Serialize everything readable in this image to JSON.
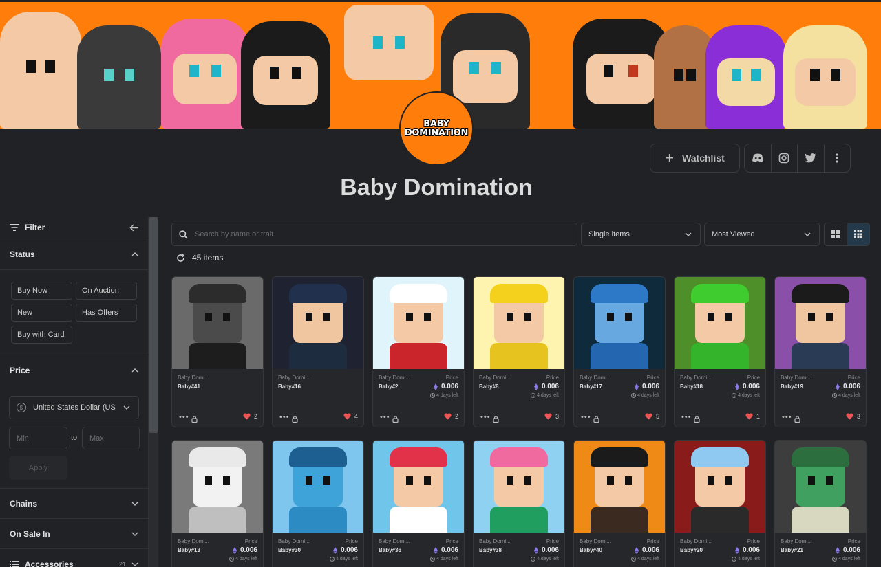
{
  "collection": {
    "title": "Baby Domination",
    "logo_line1": "BABY",
    "logo_line2": "DOMINATION"
  },
  "header": {
    "watchlist_label": "Watchlist",
    "social_icons": [
      "discord-icon",
      "instagram-icon",
      "twitter-icon",
      "more-vertical-icon"
    ]
  },
  "sidebar": {
    "filter_label": "Filter",
    "status": {
      "label": "Status",
      "options": [
        "Buy Now",
        "On Auction",
        "New",
        "Has Offers",
        "Buy with Card"
      ]
    },
    "price": {
      "label": "Price",
      "currency": "United States Dollar (US",
      "min_placeholder": "Min",
      "to_label": "to",
      "max_placeholder": "Max",
      "apply_label": "Apply"
    },
    "chains_label": "Chains",
    "on_sale_label": "On Sale In",
    "accessories_label": "Accessories",
    "accessories_count": "21"
  },
  "toolbar": {
    "search_placeholder": "Search by name or trait",
    "type_select": "Single items",
    "sort_select": "Most Viewed",
    "item_count": "45 items"
  },
  "colors": {
    "banner": "#ff7e0b",
    "background": "#202225",
    "like_heart": "#eb5757",
    "eth": "#8a7bf3"
  },
  "items": [
    {
      "collection": "Baby Domi...",
      "name": "Baby#41",
      "price_label": "",
      "price": "",
      "time_left": "",
      "likes": "2",
      "bg": "#6a6a6a",
      "skin": "#4b4b4b",
      "hat": "#2c2c2c",
      "shirt": "#1d1d1d"
    },
    {
      "collection": "Baby Domi...",
      "name": "Baby#16",
      "price_label": "",
      "price": "",
      "time_left": "",
      "likes": "4",
      "bg": "#1f2230",
      "skin": "#f0c6a0",
      "hat": "#21304d",
      "shirt": "#1d2d3f"
    },
    {
      "collection": "Baby Domi...",
      "name": "Baby#2",
      "price_label": "Price",
      "price": "0.006",
      "time_left": "4 days left",
      "likes": "2",
      "bg": "#dff4fb",
      "skin": "#f3c9a6",
      "hat": "#ffffff",
      "shirt": "#c9252a"
    },
    {
      "collection": "Baby Domi...",
      "name": "Baby#8",
      "price_label": "Price",
      "price": "0.006",
      "time_left": "4 days left",
      "likes": "3",
      "bg": "#fff3b0",
      "skin": "#f3c9a6",
      "hat": "#f4d11d",
      "shirt": "#e6c31f"
    },
    {
      "collection": "Baby Domi...",
      "name": "Baby#17",
      "price_label": "Price",
      "price": "0.006",
      "time_left": "4 days left",
      "likes": "5",
      "bg": "#0f2a3a",
      "skin": "#67a8e0",
      "hat": "#2e78c8",
      "shirt": "#2466b0"
    },
    {
      "collection": "Baby Domi...",
      "name": "Baby#18",
      "price_label": "Price",
      "price": "0.006",
      "time_left": "4 days left",
      "likes": "1",
      "bg": "#4e8f2a",
      "skin": "#f3c9a6",
      "hat": "#3fcc2e",
      "shirt": "#33b42a"
    },
    {
      "collection": "Baby Domi...",
      "name": "Baby#19",
      "price_label": "Price",
      "price": "0.006",
      "time_left": "4 days left",
      "likes": "3",
      "bg": "#8a4fa8",
      "skin": "#f0c6a0",
      "hat": "#1b1b1b",
      "shirt": "#2a3b55"
    },
    {
      "collection": "Baby Domi...",
      "name": "Baby#13",
      "price_label": "Price",
      "price": "0.006",
      "time_left": "4 days left",
      "likes": "",
      "bg": "#7a7a7a",
      "skin": "#f2f2f2",
      "hat": "#e9e9e9",
      "shirt": "#bfbfbf"
    },
    {
      "collection": "Baby Domi...",
      "name": "Baby#30",
      "price_label": "Price",
      "price": "0.006",
      "time_left": "4 days left",
      "likes": "",
      "bg": "#7ec6ee",
      "skin": "#3ea3d8",
      "hat": "#1e5f92",
      "shirt": "#2d8bc4"
    },
    {
      "collection": "Baby Domi...",
      "name": "Baby#36",
      "price_label": "Price",
      "price": "0.006",
      "time_left": "4 days left",
      "likes": "",
      "bg": "#6fc6ea",
      "skin": "#f3c9a6",
      "hat": "#e2324a",
      "shirt": "#ffffff"
    },
    {
      "collection": "Baby Domi...",
      "name": "Baby#38",
      "price_label": "Price",
      "price": "0.006",
      "time_left": "4 days left",
      "likes": "",
      "bg": "#8fd1f0",
      "skin": "#f3c9a6",
      "hat": "#f06aa0",
      "shirt": "#1f9e60"
    },
    {
      "collection": "Baby Domi...",
      "name": "Baby#40",
      "price_label": "Price",
      "price": "0.006",
      "time_left": "4 days left",
      "likes": "",
      "bg": "#f08a16",
      "skin": "#f3c9a6",
      "hat": "#1b1b1b",
      "shirt": "#3a2a20"
    },
    {
      "collection": "Baby Domi...",
      "name": "Baby#20",
      "price_label": "Price",
      "price": "0.006",
      "time_left": "4 days left",
      "likes": "",
      "bg": "#8a1b1b",
      "skin": "#f3c9a6",
      "hat": "#8fc8f0",
      "shirt": "#2a2a2a"
    },
    {
      "collection": "Baby Domi...",
      "name": "Baby#21",
      "price_label": "Price",
      "price": "0.006",
      "time_left": "4 days left",
      "likes": "",
      "bg": "#3d3d3d",
      "skin": "#3fa060",
      "hat": "#2c6e3e",
      "shirt": "#d8d8c0"
    }
  ]
}
